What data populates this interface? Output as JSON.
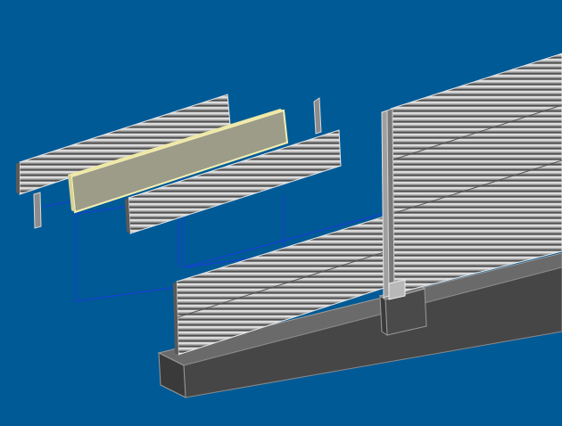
{
  "scene": {
    "description_visible_text": "",
    "colors": {
      "background": "#005a96",
      "panel_face": "#8c8c8c",
      "panel_ridge_light": "#d8d8d8",
      "panel_ridge_dark": "#5a5a5a",
      "absorber_face": "#9b9b86",
      "absorber_edge": "#f3eeb0",
      "foundation_front": "#4a4a4a",
      "foundation_top": "#6a6a6a",
      "explode_line": "#1030d0",
      "post": "#9a9a9a"
    }
  }
}
